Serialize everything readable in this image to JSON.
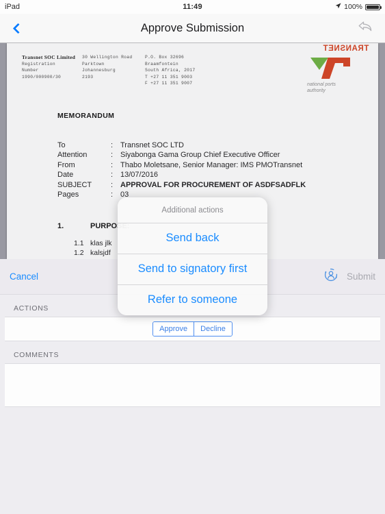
{
  "statusbar": {
    "device": "iPad",
    "time": "11:49",
    "battery_percent": "100%",
    "location_icon": "location-arrow-icon",
    "battery_icon": "battery-full-icon"
  },
  "navbar": {
    "title": "Approve Submission",
    "back_icon": "back-chevron-icon",
    "reply_icon": "reply-arrow-icon"
  },
  "document": {
    "header": {
      "col1": [
        "Transnet SOC Limited",
        "Registration",
        "Number",
        "1990/000900/30"
      ],
      "col2": [
        "30 Wellington Road",
        "Parktown",
        "Johannesburg",
        "2193"
      ],
      "col3": [
        "P.O. Box 32696",
        "Braamfontein",
        "South Africa, 2017",
        "T +27 11 351 9003",
        "F +27 11 351 9007"
      ]
    },
    "logo": {
      "wordmark": "TRANSNET",
      "subtitle_line1": "national ports",
      "subtitle_line2": "authority",
      "green": "#6cb33f",
      "red": "#d7401f"
    },
    "memo_title": "MEMORANDUM",
    "fields": [
      {
        "label": "To",
        "value": "Transnet SOC LTD",
        "bold": false
      },
      {
        "label": "Attention",
        "value": "Siyabonga Gama Group Chief Executive Officer",
        "bold": false
      },
      {
        "label": "From",
        "value": "Thabo Moletsane, Senior Manager: IMS PMOTransnet",
        "bold": false
      },
      {
        "label": "Date",
        "value": "13/07/2016",
        "bold": false
      },
      {
        "label": "SUBJECT",
        "value": "APPROVAL FOR PROCUREMENT OF ASDFSADFLK",
        "bold": true
      },
      {
        "label": "Pages",
        "value": "03",
        "bold": false
      }
    ],
    "section_number": "1.",
    "section_title": "PURPOSE:",
    "items": [
      {
        "num": "1.1",
        "text": "klas jlk"
      },
      {
        "num": "1.2",
        "text": "kalsjdf"
      }
    ]
  },
  "toolbar": {
    "cancel_label": "Cancel",
    "submit_label": "Submit",
    "delegate_icon": "reassign-user-icon",
    "accent": "#1a8cff",
    "disabled": "#a9a9b0"
  },
  "form": {
    "actions_header": "ACTIONS",
    "approve_label": "Approve",
    "decline_label": "Decline",
    "comments_header": "COMMENTS",
    "comments_value": ""
  },
  "popover": {
    "title": "Additional actions",
    "options": [
      {
        "label": "Send back"
      },
      {
        "label": "Send to signatory first"
      },
      {
        "label": "Refer to someone"
      }
    ]
  }
}
